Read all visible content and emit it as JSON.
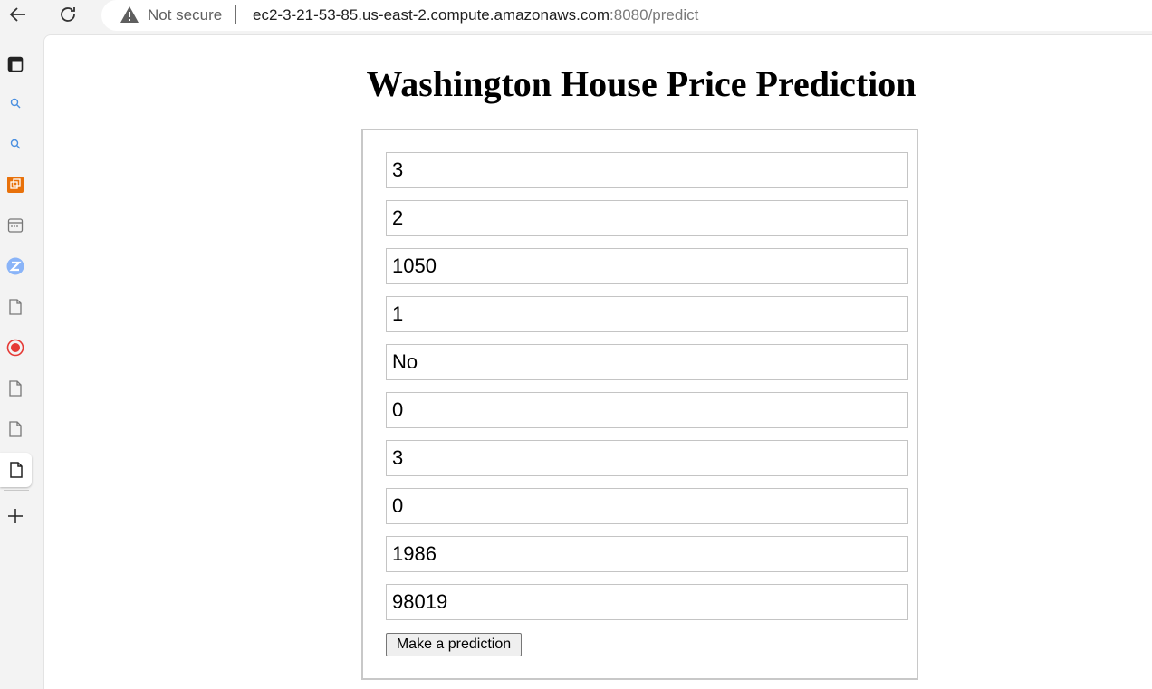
{
  "browser": {
    "security_label": "Not secure",
    "url_host": "ec2-3-21-53-85.us-east-2.compute.amazonaws.com",
    "url_rest": ":8080/predict"
  },
  "sidebar": {
    "items": [
      {
        "icon": "tab-strip-icon"
      },
      {
        "icon": "search-icon"
      },
      {
        "icon": "search-icon"
      },
      {
        "icon": "app-orange-icon"
      },
      {
        "icon": "calendar-window-icon"
      },
      {
        "icon": "z-app-icon"
      },
      {
        "icon": "page-icon"
      },
      {
        "icon": "record-icon"
      },
      {
        "icon": "page-icon"
      },
      {
        "icon": "page-icon"
      },
      {
        "icon": "page-icon"
      }
    ],
    "add_icon": "plus-icon"
  },
  "page": {
    "title": "Washington House Price Prediction",
    "fields": [
      "3",
      "2",
      "1050",
      "1",
      "No",
      "0",
      "3",
      "0",
      "1986",
      "98019"
    ],
    "submit_label": "Make a prediction"
  },
  "colors": {
    "warning": "#5f5f5f",
    "record_red": "#e53935",
    "z_blue": "#8ab4f8",
    "orange": "#e8710a"
  }
}
